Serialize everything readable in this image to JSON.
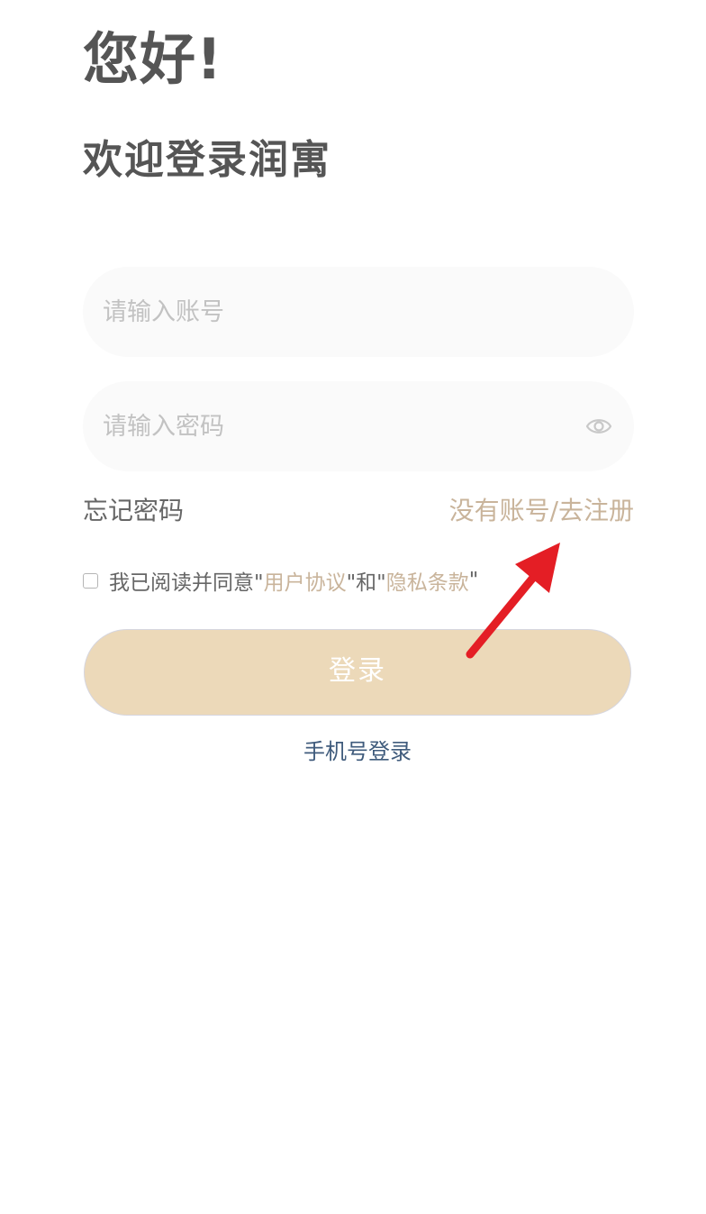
{
  "header": {
    "greeting": "您好!",
    "welcome": "欢迎登录润寓"
  },
  "form": {
    "account_placeholder": "请输入账号",
    "password_placeholder": "请输入密码",
    "forgot_password": "忘记密码",
    "register_link": "没有账号/去注册",
    "agreement": {
      "prefix": "我已阅读并同意\"",
      "user_agreement": "用户协议",
      "middle": "\"和\"",
      "privacy_policy": "隐私条款",
      "suffix": "\"",
      "checked": false
    },
    "login_button": "登录",
    "phone_login": "手机号登录"
  },
  "icons": {
    "password_toggle": "eye-icon"
  },
  "colors": {
    "text_dark": "#555555",
    "placeholder": "#c2c2c2",
    "accent_gold": "#c9b49b",
    "button_bg": "#ecd9b9",
    "phone_link": "#3f5b7c",
    "annotation_arrow": "#e41e25"
  }
}
